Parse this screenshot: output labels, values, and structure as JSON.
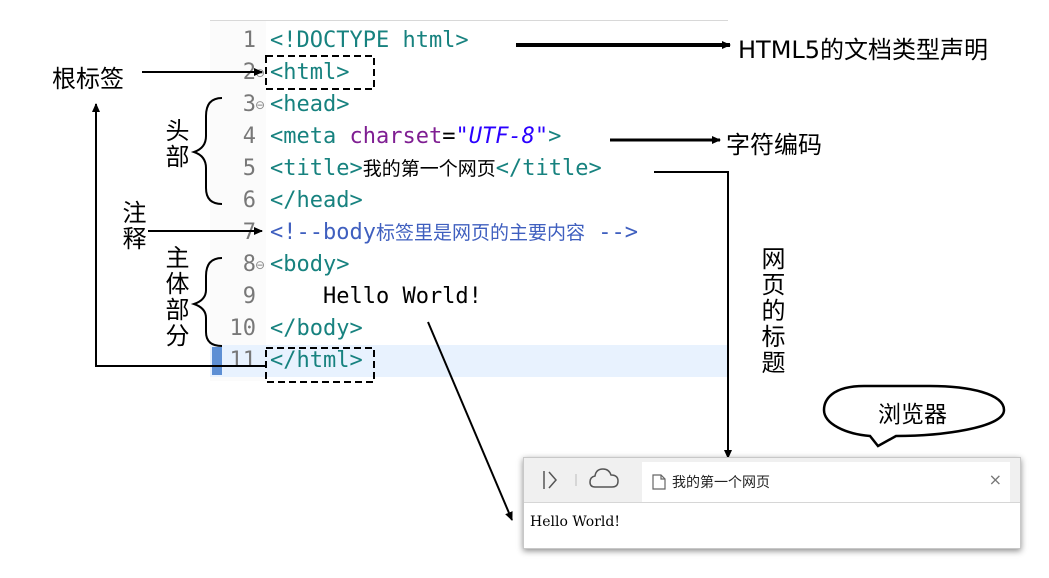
{
  "code_lines": [
    {
      "num": "1",
      "parts": [
        {
          "t": "<!DOCTYPE html>",
          "c": "tag"
        }
      ]
    },
    {
      "num": "2",
      "fold": "⊖",
      "parts": [
        {
          "t": "<html>",
          "c": "tag"
        }
      ]
    },
    {
      "num": "3",
      "fold": "⊖",
      "parts": [
        {
          "t": "<head>",
          "c": "tag"
        }
      ]
    },
    {
      "num": "4",
      "parts": [
        {
          "t": "<meta ",
          "c": "tag"
        },
        {
          "t": "charset",
          "c": "attr"
        },
        {
          "t": "=",
          "c": "eq"
        },
        {
          "t": "\"UTF-8\"",
          "c": "str"
        },
        {
          "t": ">",
          "c": "tag"
        }
      ]
    },
    {
      "num": "5",
      "parts": [
        {
          "t": "<title>",
          "c": "tag"
        },
        {
          "t": "我的第一个网页",
          "c": "txt-cjk"
        },
        {
          "t": "</title>",
          "c": "tag"
        }
      ]
    },
    {
      "num": "6",
      "parts": [
        {
          "t": "</head>",
          "c": "tag"
        }
      ]
    },
    {
      "num": "7",
      "parts": [
        {
          "t": "<!--body",
          "c": "comment"
        },
        {
          "t": "标签里是网页的主要内容",
          "c": "comment-cjk"
        },
        {
          "t": " -->",
          "c": "comment"
        }
      ]
    },
    {
      "num": "8",
      "fold": "⊖",
      "parts": [
        {
          "t": "<body>",
          "c": "tag"
        }
      ]
    },
    {
      "num": "9",
      "parts": [
        {
          "t": "    Hello World!",
          "c": "txt"
        }
      ]
    },
    {
      "num": "10",
      "parts": [
        {
          "t": "</body>",
          "c": "tag"
        }
      ]
    },
    {
      "num": "11",
      "current": true,
      "parts": [
        {
          "t": "</html>",
          "c": "tag"
        }
      ]
    }
  ],
  "annotations": {
    "doctype": "HTML5的文档类型声明",
    "root_tag": "根标签",
    "head_part": "头部",
    "charset": "字符编码",
    "comment": "注释",
    "body_part": "主体部分",
    "page_title": "网页的标题",
    "browser": "浏览器"
  },
  "browser": {
    "tab_title": "我的第一个网页",
    "close": "×",
    "content": "Hello World!"
  }
}
